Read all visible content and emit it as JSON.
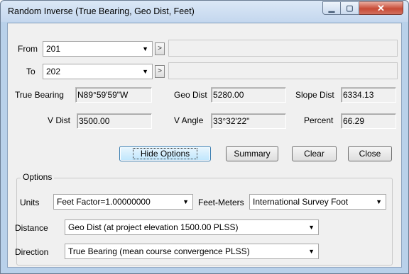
{
  "window": {
    "title": "Random Inverse (True Bearing, Geo Dist, Feet)"
  },
  "titlebar_buttons": {
    "minimize": "▁",
    "maximize": "▢",
    "close": "✕"
  },
  "from": {
    "label": "From",
    "value": "201",
    "pick": ">"
  },
  "to": {
    "label": "To",
    "value": "202",
    "pick": ">"
  },
  "results": {
    "true_bearing_label": "True Bearing",
    "true_bearing": "N89°59'59\"W",
    "geo_dist_label": "Geo Dist",
    "geo_dist": "5280.00",
    "slope_dist_label": "Slope Dist",
    "slope_dist": "6334.13",
    "v_dist_label": "V Dist",
    "v_dist": "3500.00",
    "v_angle_label": "V Angle",
    "v_angle": "33°32'22\"",
    "percent_label": "Percent",
    "percent": "66.29"
  },
  "buttons": {
    "hide_options": "Hide Options",
    "summary": "Summary",
    "clear": "Clear",
    "close": "Close"
  },
  "options": {
    "title": "Options",
    "units_label": "Units",
    "units": "Feet  Factor=1.00000000",
    "feet_meters_label": "Feet-Meters",
    "feet_meters": "International Survey Foot",
    "distance_label": "Distance",
    "distance": "Geo Dist (at project elevation 1500.00 PLSS)",
    "direction_label": "Direction",
    "direction": "True Bearing (mean course convergence PLSS)"
  },
  "dropdown_arrow": "▼"
}
